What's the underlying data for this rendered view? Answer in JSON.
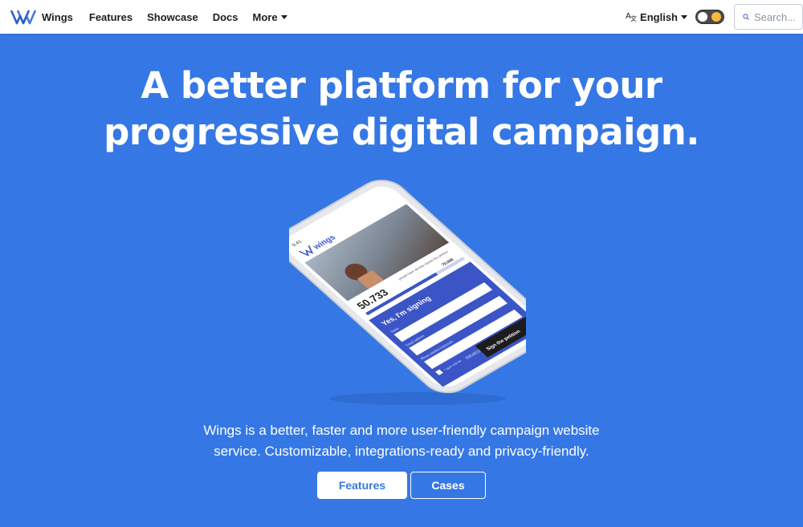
{
  "nav": {
    "brand": "Wings",
    "links": [
      "Features",
      "Showcase",
      "Docs"
    ],
    "more_label": "More",
    "language_label": "English",
    "language_icon_glyph": "A",
    "search_placeholder": "Search..."
  },
  "hero": {
    "title_line1": "A better platform for your",
    "title_line2": "progressive digital campaign.",
    "description_line1": "Wings is a better, faster and more user-friendly campaign website",
    "description_line2": "service. Customizable, integrations-ready and privacy-friendly.",
    "primary_button": "Features",
    "secondary_button": "Cases"
  },
  "phone": {
    "status_time": "9:41",
    "app_name": "wings",
    "signatures": "50.733",
    "signatures_note": "people have already signed this petition",
    "goal": "70.000",
    "form_title": "Yes, I'm signing",
    "field_name": "Name",
    "field_email": "Email address",
    "field_phone": "Phone number (optional)",
    "consent_prefix": "I agree with the",
    "consent_link": "terms and conditions",
    "submit_label": "Sign the petition",
    "progress": 0.72
  },
  "colors": {
    "background": "#3578e5",
    "form_panel": "#3b55c7",
    "submit": "#1c1c1c",
    "brand_logo": "#2962c9"
  },
  "icons": {
    "brand": "wings-logo-icon",
    "language": "translate-icon",
    "theme_toggle": "dark-mode-toggle-icon",
    "search": "search-icon"
  }
}
